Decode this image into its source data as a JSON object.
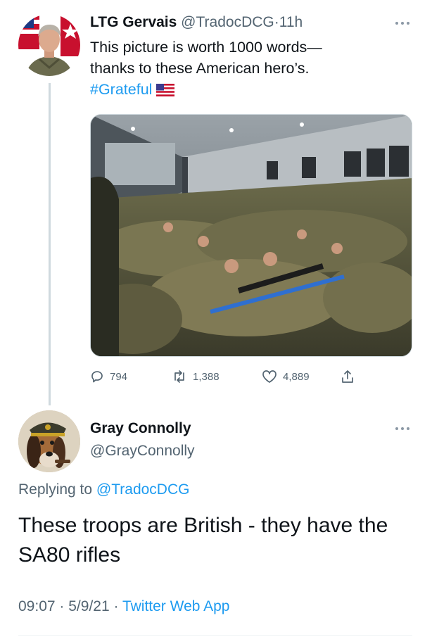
{
  "tweet": {
    "author_name": "LTG Gervais",
    "handle": "@TradocDCG",
    "separator": "·",
    "time": "11h",
    "more_icon": "more-horizontal-icon",
    "text_line1": "This picture is worth 1000 words—",
    "text_line2": "thanks to these American hero’s.",
    "hashtag": "#Grateful",
    "flag_emoji": "us-flag-icon",
    "actions": {
      "replies": "794",
      "retweets": "1,388",
      "likes": "4,889"
    }
  },
  "reply": {
    "author_name": "Gray Connolly",
    "handle": "@GrayConnolly",
    "replying_prefix": "Replying to",
    "replying_handle": "@TradocDCG",
    "text": "These troops are British - they have the SA80 rifles",
    "time": "09:07",
    "date": "5/9/21",
    "separator": "·",
    "source": "Twitter Web App"
  },
  "colors": {
    "link": "#1d9bf0",
    "muted": "#536471",
    "thread_line": "#cfd9de",
    "text": "#0f1419"
  }
}
